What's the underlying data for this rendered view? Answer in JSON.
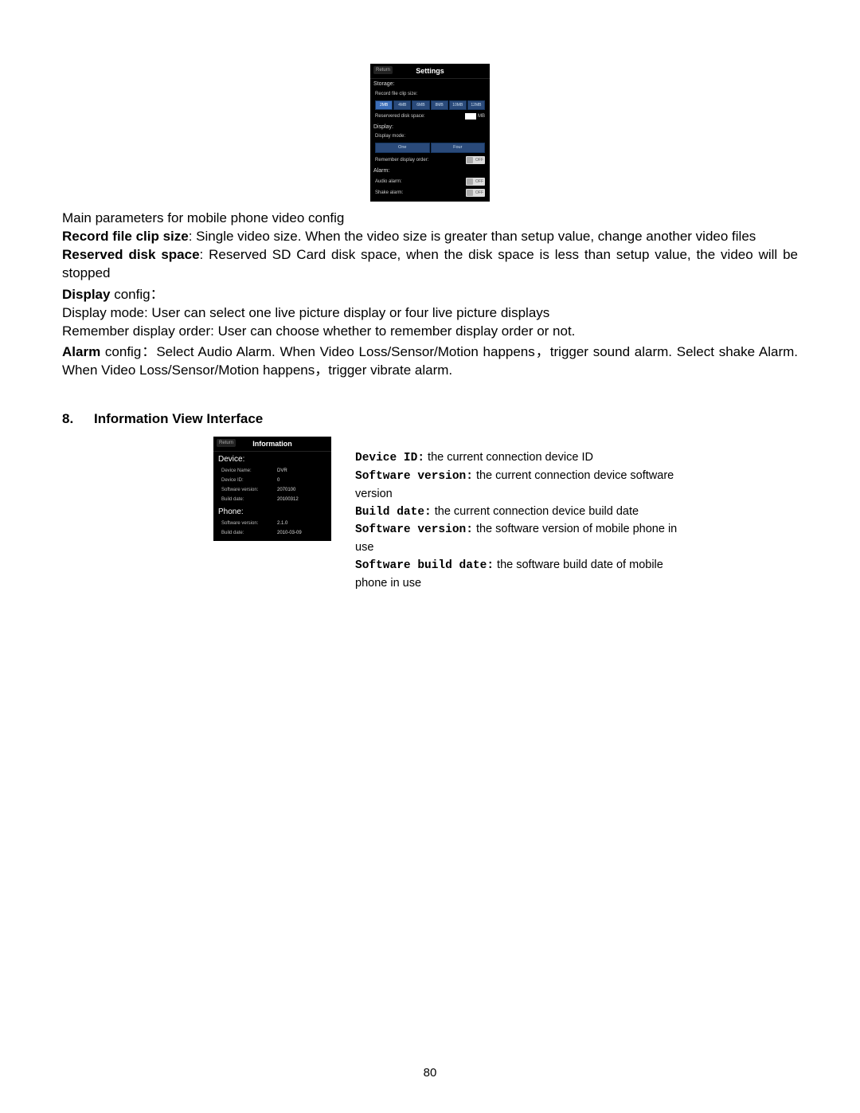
{
  "settings_screenshot": {
    "return": "Return",
    "title": "Settings",
    "storage_label": "Storage:",
    "record_clip_label": "Record file clip size:",
    "clip_sizes": [
      "2MB",
      "4MB",
      "6MB",
      "8MB",
      "10MB",
      "12MB"
    ],
    "reserved_label": "Reservered disk space:",
    "reserved_unit": "MB",
    "display_label": "Display:",
    "display_mode_label": "Display mode:",
    "display_mode_options": [
      "One",
      "Four"
    ],
    "remember_label": "Remember display order:",
    "alarm_label": "Alarm:",
    "audio_alarm_label": "Audio alarm:",
    "shake_alarm_label": "Shake alarm:",
    "off": "OFF"
  },
  "body": {
    "main_params": "Main parameters for mobile phone video config",
    "record_bold": "Record file clip size",
    "record_text": ": Single video size. When the video size is greater than setup value, change another video files",
    "reserved_bold": "Reserved disk space",
    "reserved_text": ": Reserved SD Card disk space, when the disk space is less than setup value, the video will be stopped",
    "display_bold": "Display",
    "display_config": " config：",
    "display_mode_line": "Display mode: User can select one live picture display or four live picture displays",
    "remember_line": "Remember display order: User can choose whether to remember display order or not.",
    "alarm_bold": "Alarm",
    "alarm_text": " config：Select Audio Alarm. When Video Loss/Sensor/Motion happens，trigger sound alarm. Select shake Alarm. When Video Loss/Sensor/Motion happens，trigger vibrate alarm."
  },
  "section8": {
    "num": "8.",
    "title": "Information View Interface"
  },
  "info_screenshot": {
    "return": "Return",
    "title": "Information",
    "device_label": "Device:",
    "device_name_lbl": "Device Name:",
    "device_name_val": "DVR",
    "device_id_lbl": "Device ID:",
    "device_id_val": "0",
    "sw_ver_lbl": "Software version:",
    "sw_ver_val": "2070100",
    "build_date_lbl": "Build date:",
    "build_date_val": "20100312",
    "phone_label": "Phone:",
    "phone_sw_ver_lbl": "Software version:",
    "phone_sw_ver_val": "2.1.0",
    "phone_build_lbl": "Build date:",
    "phone_build_val": "2010-03-09"
  },
  "info_desc": {
    "device_id_lbl": "Device ID:",
    "device_id_txt": " the current connection device ID",
    "sw_ver_lbl": "Software version:",
    "sw_ver_txt": " the current connection device software version",
    "build_date_lbl": "Build date:",
    "build_date_txt": " the current connection device build date",
    "sw_ver2_lbl": "Software version:",
    "sw_ver2_txt": " the software version of mobile phone in use",
    "sw_build_lbl": "Software build date:",
    "sw_build_txt": " the software build date of mobile  phone in use"
  },
  "page_number": "80"
}
